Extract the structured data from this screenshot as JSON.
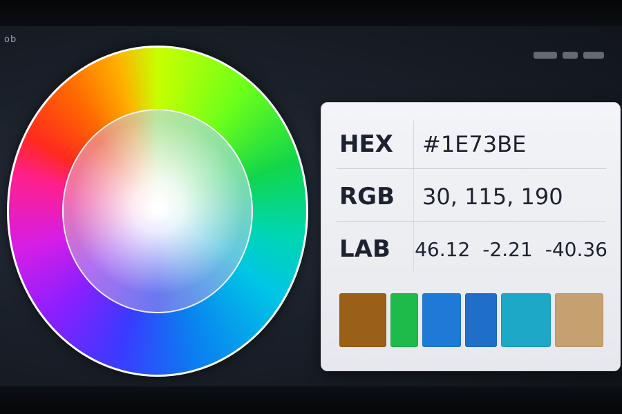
{
  "corner_label": "ob",
  "color_wheel": {
    "selected_position": "center"
  },
  "panel": {
    "hex": {
      "label": "HEX",
      "value": "#1E73BE"
    },
    "rgb": {
      "label": "RGB",
      "value": "30, 115, 190"
    },
    "lab": {
      "label": "LAB",
      "l": "46.12",
      "a": "-2.21",
      "b": "-40.36"
    }
  },
  "swatches": [
    {
      "color": "#9a6018"
    },
    {
      "color": "#1fbb4a"
    },
    {
      "color": "#1e7ad6"
    },
    {
      "color": "#1f6ec8"
    },
    {
      "color": "#1ea8c8"
    },
    {
      "color": "#c6a070"
    }
  ]
}
